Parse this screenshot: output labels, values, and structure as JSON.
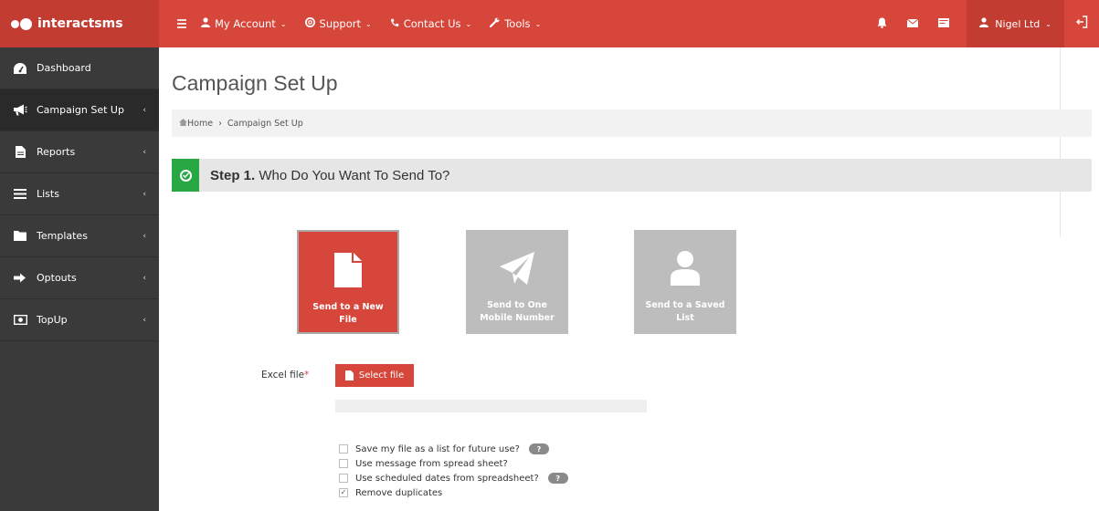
{
  "brand": {
    "name": "interactsms"
  },
  "topnav": {
    "items": [
      {
        "label": "My Account",
        "icon": "user-icon"
      },
      {
        "label": "Support",
        "icon": "lifebuoy-icon"
      },
      {
        "label": "Contact Us",
        "icon": "phone-icon"
      },
      {
        "label": "Tools",
        "icon": "wrench-icon"
      }
    ],
    "right_icons": [
      "bell-icon",
      "envelope-icon",
      "card-icon"
    ],
    "user": {
      "name": "Nigel Ltd"
    }
  },
  "sidebar": {
    "items": [
      {
        "label": "Dashboard",
        "icon": "dashboard-icon",
        "active": false
      },
      {
        "label": "Campaign Set Up",
        "icon": "megaphone-icon",
        "active": true
      },
      {
        "label": "Reports",
        "icon": "file-icon",
        "active": false
      },
      {
        "label": "Lists",
        "icon": "list-icon",
        "active": false
      },
      {
        "label": "Templates",
        "icon": "folder-icon",
        "active": false
      },
      {
        "label": "Optouts",
        "icon": "sign-out-icon",
        "active": false
      },
      {
        "label": "TopUp",
        "icon": "money-icon",
        "active": false
      }
    ]
  },
  "page": {
    "title": "Campaign Set Up",
    "breadcrumb": {
      "home": "Home",
      "separator": "›",
      "current": "Campaign Set Up"
    }
  },
  "step": {
    "number": "Step 1.",
    "question": "Who Do You Want To Send To?"
  },
  "tiles": [
    {
      "label": "Send to a New File",
      "icon": "file-icon",
      "selected": true
    },
    {
      "label": "Send to One Mobile Number",
      "icon": "paper-plane-icon",
      "selected": false
    },
    {
      "label": "Send to a Saved List",
      "icon": "person-icon",
      "selected": false
    }
  ],
  "form": {
    "excel_label": "Excel file",
    "required_mark": "*",
    "select_button": "Select file",
    "help_glyph": "?",
    "checkboxes": [
      {
        "label": "Save my file as a list for future use?",
        "checked": false,
        "help": true
      },
      {
        "label": "Use message from spread sheet?",
        "checked": false,
        "help": false
      },
      {
        "label": "Use scheduled dates from spreadsheet?",
        "checked": false,
        "help": true
      },
      {
        "label": "Remove duplicates",
        "checked": true,
        "help": false
      }
    ]
  },
  "colors": {
    "brand_red": "#d6463a",
    "brand_red_dark": "#c33c31",
    "sidebar": "#3a3a3a",
    "success": "#28a745",
    "tile_gray": "#bdbdbd"
  }
}
